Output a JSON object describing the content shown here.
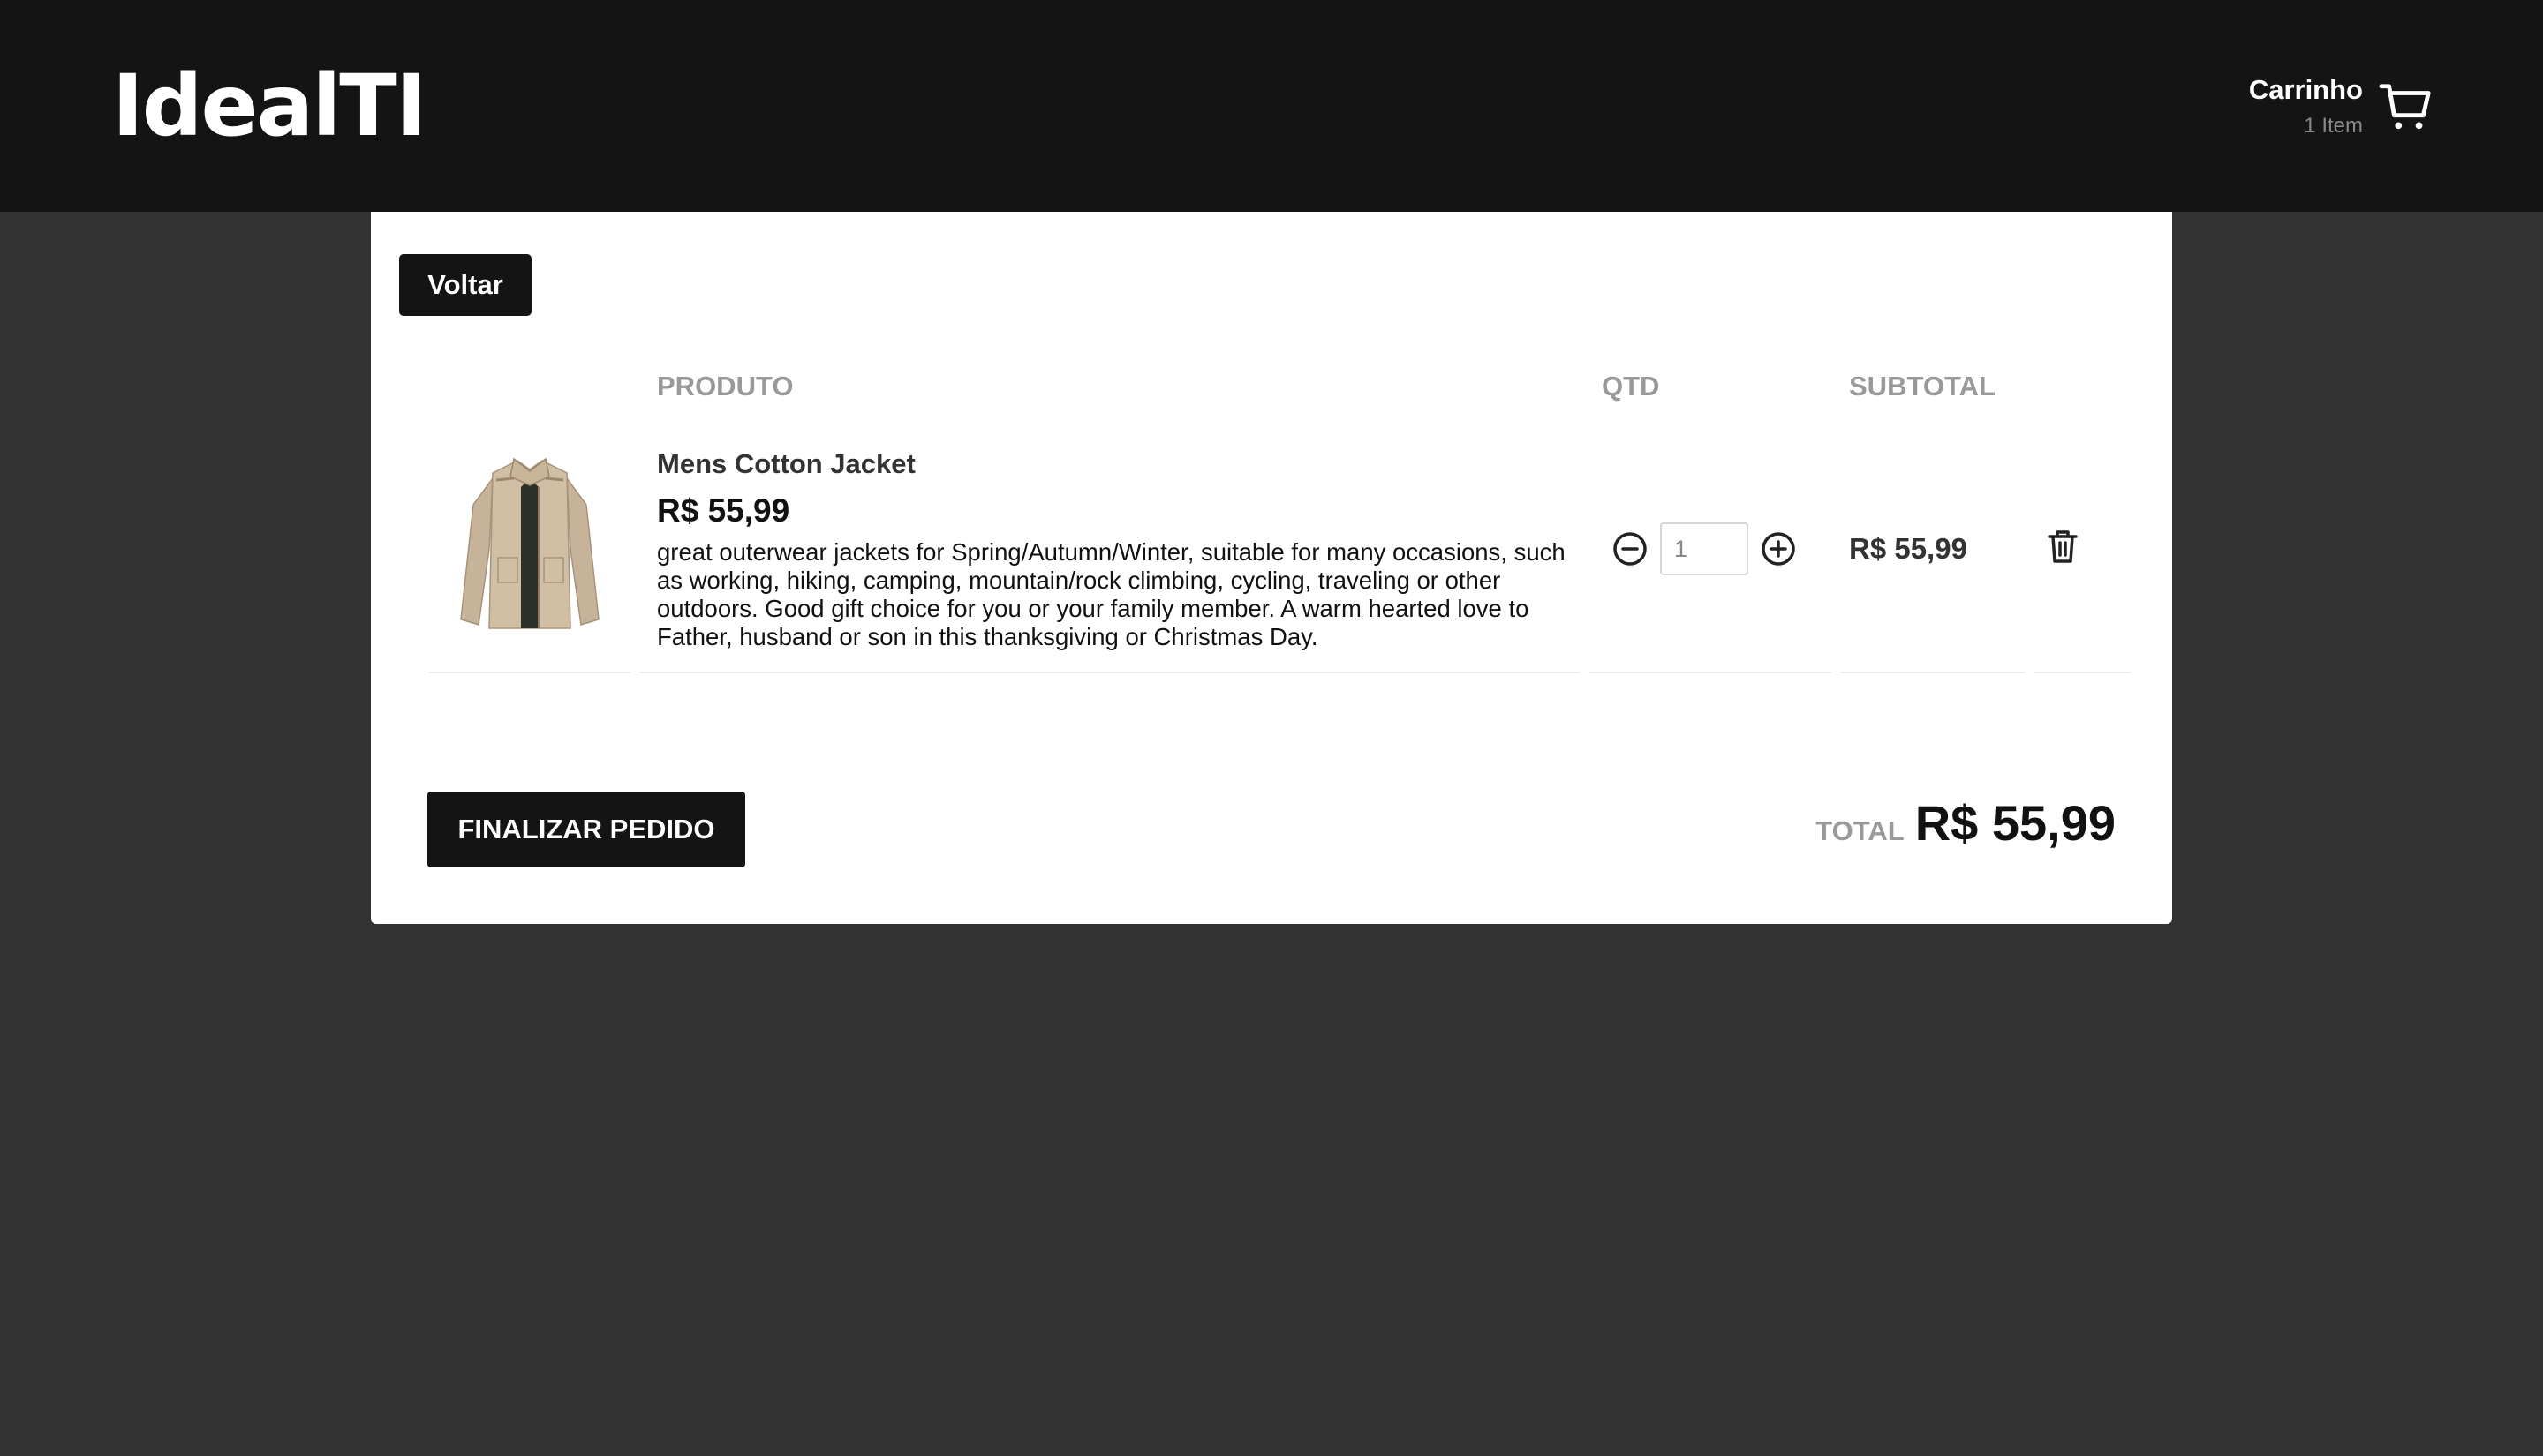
{
  "header": {
    "logo": "IdealTI",
    "cart": {
      "title": "Carrinho",
      "count": "1 Item",
      "icon": "cart-icon"
    }
  },
  "page": {
    "back_label": "Voltar",
    "columns": {
      "product": "PRODUTO",
      "qty": "QTD",
      "subtotal": "SUBTOTAL"
    },
    "items": [
      {
        "image_icon": "jacket-image",
        "name": "Mens Cotton Jacket",
        "price": "R$ 55,99",
        "description": "great outerwear jackets for Spring/Autumn/Winter, suitable for many occasions, such as working, hiking, camping, mountain/rock climbing, cycling, traveling or other outdoors. Good gift choice for you or your family member. A warm hearted love to Father, husband or son in this thanksgiving or Christmas Day.",
        "quantity": "1",
        "subtotal": "R$ 55,99"
      }
    ],
    "finalize_label": "FINALIZAR PEDIDO",
    "total_label": "TOTAL",
    "total_value": "R$ 55,99"
  },
  "colors": {
    "header_bg": "#141414",
    "page_bg": "#333333",
    "card_bg": "#ffffff",
    "button_bg": "#141414",
    "muted_text": "#999999"
  }
}
